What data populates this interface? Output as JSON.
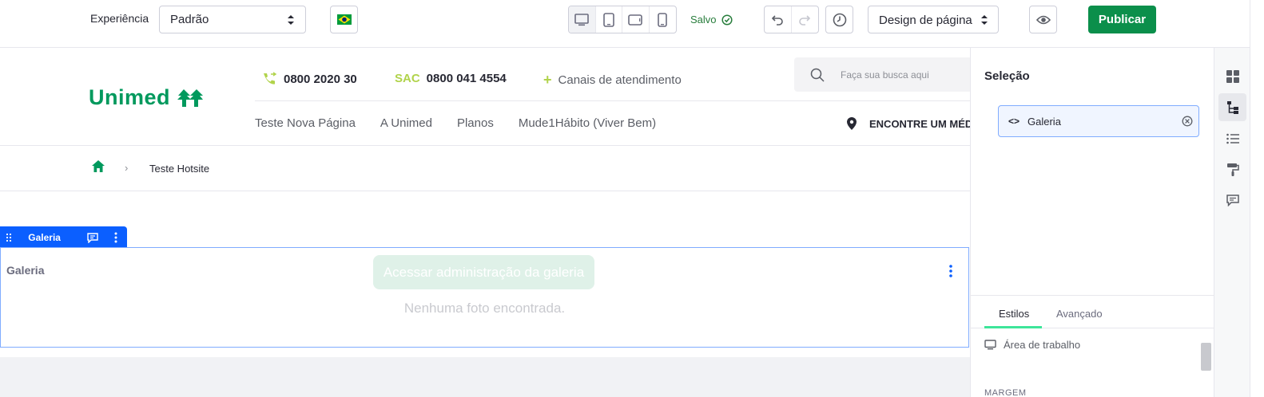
{
  "toolbar": {
    "experience_label": "Experiência",
    "experience_value": "Padrão",
    "saved_label": "Salvo",
    "page_design_value": "Design de página",
    "publish_label": "Publicar",
    "colors": {
      "publish": "#0b8f4b",
      "saved": "#287d3c"
    }
  },
  "site": {
    "logo_text": "Unimed",
    "phone": "0800 2020 30",
    "sac_label": "SAC",
    "sac_phone": "0800 041 4554",
    "channels_label": "Canais de atendimento",
    "search_placeholder": "Faça sua busca aqui",
    "nav": [
      "Teste Nova Página",
      "A Unimed",
      "Planos",
      "Mude1Hábito (Viver Bem)"
    ],
    "find_doctor": "ENCONTRE UM MÉDICO",
    "colors": {
      "brand": "#00995d",
      "accent": "#b1d34b"
    }
  },
  "breadcrumb": {
    "separator": "›",
    "current": "Teste Hotsite"
  },
  "fragment": {
    "tag_label": "Galeria",
    "title": "Galeria",
    "admin_button": "Acessar administração da galeria",
    "empty_message": "Nenhuma foto encontrada."
  },
  "side_panel": {
    "title": "Seleção",
    "selected_item": "Galeria",
    "tabs": [
      "Estilos",
      "Avançado"
    ],
    "device_label": "Área de trabalho",
    "margin_label": "MARGEM"
  }
}
